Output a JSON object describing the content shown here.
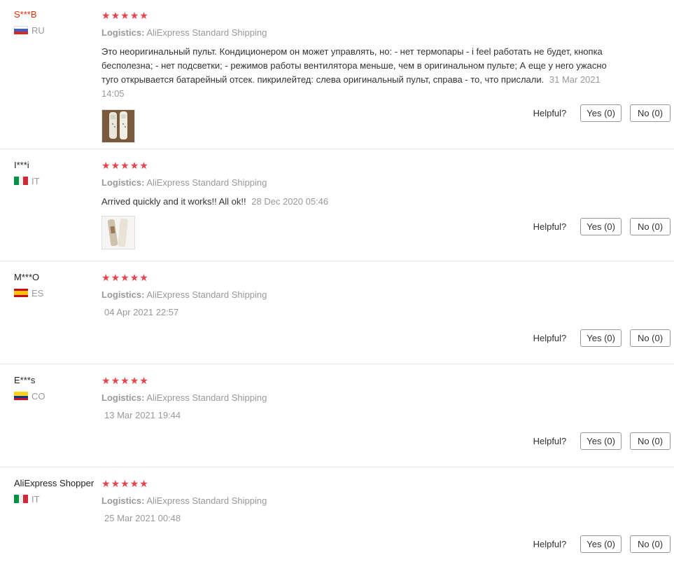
{
  "reviews": [
    {
      "user": "S***B",
      "country": "RU",
      "stars": [
        "★",
        "★",
        "★",
        "★",
        "★"
      ],
      "logistics_label": "Logistics:",
      "logistics_value": "AliExpress Standard Shipping",
      "comment": "Это неоригинальный пульт. Кондиционером он может управлять, но: - нет термопары - i feel работать не будет, кнопка бесполезна; - нет подсветки; - режимов работы вентилятора меньше, чем в оригинальном пульте; А еще у него ужасно туго открывается батарейный отсек. пикрилейтед: слева оригинальный пульт, справа - то, что прислали.",
      "date": "31 Mar 2021 14:05",
      "helpful_label": "Helpful?",
      "yes_label": "Yes (0)",
      "no_label": "No (0)"
    },
    {
      "user": "I***i",
      "country": "IT",
      "stars": [
        "★",
        "★",
        "★",
        "★",
        "★"
      ],
      "logistics_label": "Logistics:",
      "logistics_value": "AliExpress Standard Shipping",
      "comment": "Arrived quickly and it works!! All ok!!",
      "date": "28 Dec 2020 05:46",
      "helpful_label": "Helpful?",
      "yes_label": "Yes (0)",
      "no_label": "No (0)"
    },
    {
      "user": "M***O",
      "country": "ES",
      "stars": [
        "★",
        "★",
        "★",
        "★",
        "★"
      ],
      "logistics_label": "Logistics:",
      "logistics_value": "AliExpress Standard Shipping",
      "date": "04 Apr 2021 22:57",
      "helpful_label": "Helpful?",
      "yes_label": "Yes (0)",
      "no_label": "No (0)"
    },
    {
      "user": "E***s",
      "country": "CO",
      "stars": [
        "★",
        "★",
        "★",
        "★",
        "★"
      ],
      "logistics_label": "Logistics:",
      "logistics_value": "AliExpress Standard Shipping",
      "date": "13 Mar 2021 19:44",
      "helpful_label": "Helpful?",
      "yes_label": "Yes (0)",
      "no_label": "No (0)"
    },
    {
      "user": "AliExpress Shopper",
      "country": "IT",
      "stars": [
        "★",
        "★",
        "★",
        "★",
        "★"
      ],
      "logistics_label": "Logistics:",
      "logistics_value": "AliExpress Standard Shipping",
      "date": "25 Mar 2021 00:48",
      "helpful_label": "Helpful?",
      "yes_label": "Yes (0)",
      "no_label": "No (0)"
    }
  ],
  "colors": {
    "star": "#e8454a",
    "highlight_user": "#e62e04",
    "muted": "#999999"
  }
}
